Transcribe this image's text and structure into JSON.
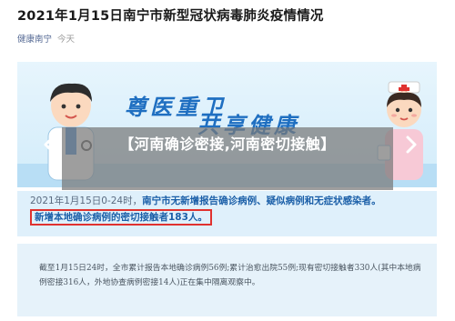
{
  "article": {
    "title": "2021年1月15日南宁市新型冠状病毒肺炎疫情情况",
    "account": "健康南宁",
    "time": "今天"
  },
  "banner": {
    "slogan_line1": "尊医重卫",
    "slogan_line2": "共享健康"
  },
  "caption": {
    "text": "【河南确诊密接,河南密切接触】"
  },
  "notice": {
    "lead": "2021年1月15日0-24时，",
    "body": "南宁市无新增报告确诊病例、疑似病例和无症状感染者。",
    "highlight": "新增本地确诊病例的密切接触者183人。"
  },
  "detail": {
    "text": "截至1月15日24时，全市累计报告本地确诊病例56例;累计治愈出院55例;现有密切接触者330人(其中本地病例密接316人，外地协查病例密接14人)正在集中隔离观察中。"
  },
  "colors": {
    "accent_blue": "#1f6fc1",
    "highlight_red": "#e0322f",
    "link": "#576b95"
  },
  "icons": {
    "prev": "chevron-left-icon",
    "next": "chevron-right-icon"
  }
}
